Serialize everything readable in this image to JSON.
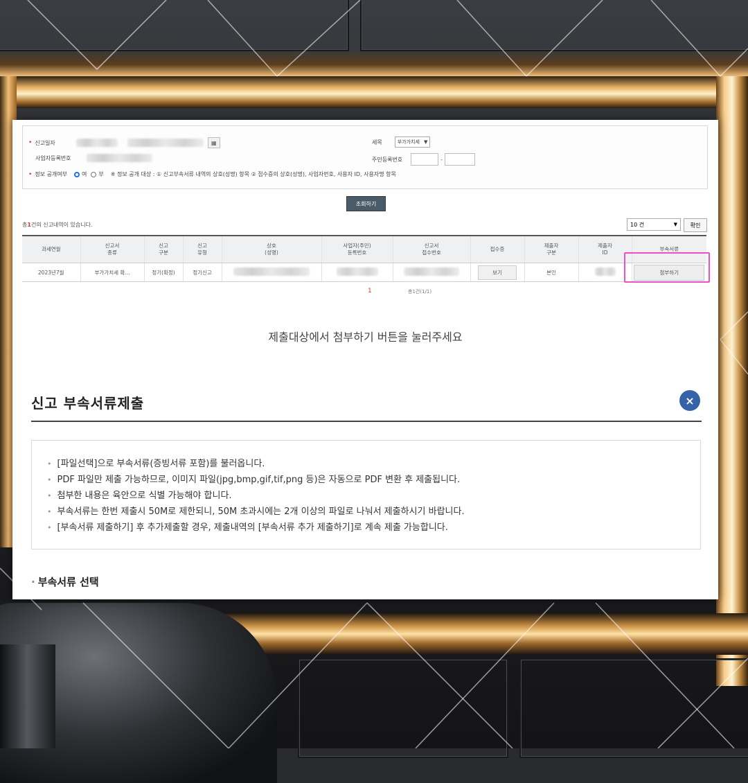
{
  "form": {
    "report_date_label": "신고일자",
    "tax_type_label": "세목",
    "tax_type_value": "부가가치세",
    "biz_no_label": "사업자등록번호",
    "resident_no_label": "주민등록번호",
    "resident_no_sep": "-",
    "disclosure_label": "정보 공개여부",
    "disclosure_yes": "여",
    "disclosure_no": "부",
    "disclosure_note": "※ 정보 공개 대상 : ① 신고부속서류 내역의 상호(성명) 항목 ② 접수증의 상호(성명), 사업자번호, 사용자 ID, 사용자명 항목"
  },
  "search_button": "조회하기",
  "result_count": {
    "prefix": "총",
    "count": "1",
    "suffix": "건의 신고내역이 있습니다."
  },
  "page_size": "10 건",
  "confirm_button": "확인",
  "table": {
    "headers": [
      [
        "과세연월",
        ""
      ],
      [
        "신고서",
        "종류"
      ],
      [
        "신고",
        "구분"
      ],
      [
        "신고",
        "유형"
      ],
      [
        "상호",
        "(성명)"
      ],
      [
        "사업자(주민)",
        "등록번호"
      ],
      [
        "신고서",
        "접수번호"
      ],
      [
        "접수증",
        ""
      ],
      [
        "제출자",
        "구분"
      ],
      [
        "제출자",
        "ID"
      ],
      [
        "부속서류",
        ""
      ]
    ],
    "row": {
      "period": "2023년7월",
      "form_type": "부가가치세 확...",
      "report_div": "정기(확정)",
      "report_type": "정기신고",
      "receipt_button": "보기",
      "submitter_div": "본인",
      "attach_button": "첨부하기"
    }
  },
  "pager": {
    "current": "1",
    "info": "총1건(1/1)"
  },
  "instruction": "제출대상에서 첨부하기 버튼을 눌러주세요",
  "modal": {
    "title": "신고 부속서류제출",
    "close_symbol": "×",
    "notices": [
      "[파일선택]으로 부속서류(증빙서류 포함)를 불러옵니다.",
      "PDF 파일만 제출 가능하므로, 이미지 파일(jpg,bmp,gif,tif,png 등)은 자동으로 PDF 변환 후 제출됩니다.",
      "첨부한 내용은 육안으로 식별 가능해야 합니다.",
      "부속서류는 한번 제출시 50M로 제한되니, 50M 초과시에는 2개 이상의 파일로 나눠서 제출하시기 바랍니다.",
      "[부속서류 제출하기] 후 추가제출할 경우, 제출내역의 [부속서류 추가 제출하기]로 계속 제출 가능합니다."
    ],
    "section_title": "부속서류 선택"
  },
  "colors": {
    "accent_red": "#e4322b",
    "close_blue": "#3463a8",
    "highlight_pink": "#ee4fc8",
    "search_button": "#4a5a66"
  },
  "icons": {
    "calendar": "calendar-icon",
    "dropdown": "chevron-down-icon",
    "close": "close-icon"
  }
}
